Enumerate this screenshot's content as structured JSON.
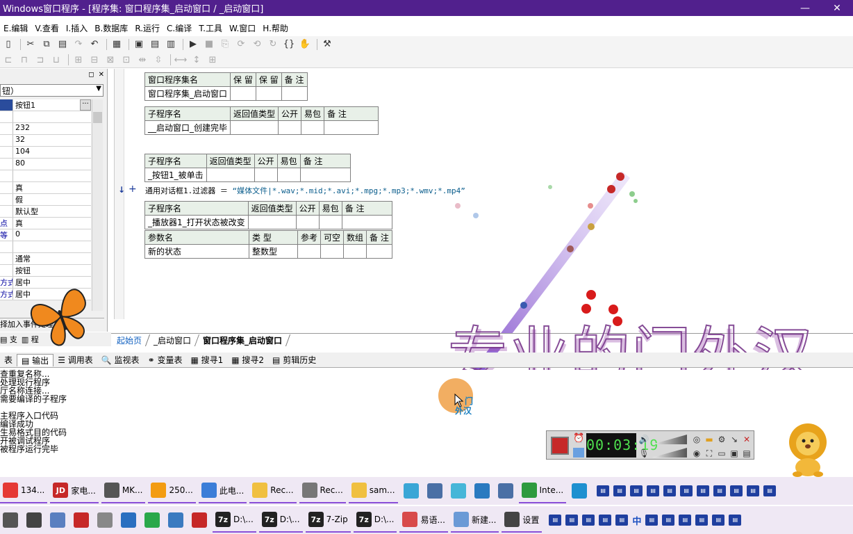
{
  "window": {
    "title": "Windows窗口程序 - [程序集: 窗口程序集_启动窗口 / _启动窗口]",
    "minimize": "—",
    "close": "✕"
  },
  "menu": [
    "E.编辑",
    "V.查看",
    "I.插入",
    "B.数据库",
    "R.运行",
    "C.编译",
    "T.工具",
    "W.窗口",
    "H.帮助"
  ],
  "left_panel": {
    "combo": "钮）",
    "properties": [
      {
        "k": "",
        "v": "按钮1"
      },
      {
        "k": "",
        "v": ""
      },
      {
        "k": "",
        "v": "232"
      },
      {
        "k": "",
        "v": "32"
      },
      {
        "k": "",
        "v": "104"
      },
      {
        "k": "",
        "v": "80"
      },
      {
        "k": "",
        "v": ""
      },
      {
        "k": "",
        "v": "真"
      },
      {
        "k": "",
        "v": "假"
      },
      {
        "k": "",
        "v": "默认型"
      },
      {
        "k": "点",
        "v": "真"
      },
      {
        "k": "等",
        "v": "0"
      },
      {
        "k": "",
        "v": ""
      },
      {
        "k": "",
        "v": "通常"
      },
      {
        "k": "",
        "v": "按钮"
      },
      {
        "k": "方式",
        "v": "居中"
      },
      {
        "k": "方式",
        "v": "居中"
      }
    ],
    "hint": "择加入事件处理子程序",
    "tabs": [
      "支",
      "程"
    ]
  },
  "editor": {
    "assembly_table": {
      "headers": [
        "窗口程序集名",
        "保 留",
        "保 留",
        "备 注"
      ],
      "row": [
        "窗口程序集_启动窗口",
        "",
        "",
        ""
      ]
    },
    "sub1": {
      "headers": [
        "子程序名",
        "返回值类型",
        "公开",
        "易包",
        "备 注"
      ],
      "row": [
        "__启动窗口_创建完毕",
        "",
        "",
        "",
        ""
      ]
    },
    "sub2": {
      "headers": [
        "子程序名",
        "返回值类型",
        "公开",
        "易包",
        "备 注"
      ],
      "row": [
        "_按钮1_被单击",
        "",
        "",
        "",
        ""
      ]
    },
    "code_line": "通用对话框1.过滤器 ＝ ",
    "code_string": "“媒体文件|*.wav;*.mid;*.avi;*.mpg;*.mp3;*.wmv;*.mp4”",
    "sub3": {
      "headers": [
        "子程序名",
        "返回值类型",
        "公开",
        "易包",
        "备 注"
      ],
      "row": [
        "_播放器1_打开状态被改变",
        "",
        "",
        "",
        ""
      ]
    },
    "params": {
      "headers": [
        "参数名",
        "类 型",
        "参考",
        "可空",
        "数组",
        "备 注"
      ],
      "row": [
        "新的状态",
        "整数型",
        "",
        "",
        "",
        ""
      ]
    },
    "marker": "↓",
    "plus": "+"
  },
  "doc_tabs": [
    "起始页",
    "_启动窗口",
    "窗口程序集_启动窗口"
  ],
  "bottom_tabs": [
    "表",
    "输出",
    "调用表",
    "监视表",
    "变量表",
    "搜寻1",
    "搜寻2",
    "剪辑历史"
  ],
  "output_lines": [
    "查重复名称...",
    "处理现行程序",
    "厅名称连接...",
    "需要编译的子程序",
    "",
    "主程序入口代码",
    "编译成功",
    "生易格式目的代码",
    "开被调试程序",
    "被程序运行完毕"
  ],
  "watermark": "专业的门外汉",
  "cursor_caption": [
    "门",
    "外汉"
  ],
  "recorder": {
    "time": "00:03:19"
  },
  "taskbar_top": [
    {
      "label": "134...",
      "icon": "chrome-icon",
      "color": "#e53935"
    },
    {
      "label": "家电...",
      "icon": "jd-icon",
      "color": "#c62828",
      "text": "JD"
    },
    {
      "label": "MK...",
      "icon": "mk-icon",
      "color": "#555"
    },
    {
      "label": "250...",
      "icon": "search-icon",
      "color": "#f39c12"
    },
    {
      "label": "此电...",
      "icon": "pc-icon",
      "color": "#3b7dd8"
    },
    {
      "label": "Rec...",
      "icon": "folder-icon",
      "color": "#f0c040"
    },
    {
      "label": "Rec...",
      "icon": "app-icon",
      "color": "#777"
    },
    {
      "label": "sam...",
      "icon": "folder-icon",
      "color": "#f0c040"
    },
    {
      "label": "",
      "icon": "swirl-icon",
      "color": "#3aa6d6"
    },
    {
      "label": "",
      "icon": "translate-icon",
      "color": "#4a6fa5"
    },
    {
      "label": "",
      "icon": "atom-icon",
      "color": "#46b6d8"
    },
    {
      "label": "",
      "icon": "db-icon",
      "color": "#2a7ac0"
    },
    {
      "label": "",
      "icon": "network-icon",
      "color": "#4a6fa5"
    },
    {
      "label": "Inte...",
      "icon": "globe-icon",
      "color": "#2e9a3e"
    },
    {
      "label": "",
      "icon": "frame-icon",
      "color": "#1e90d0"
    }
  ],
  "taskbar_bottom": [
    {
      "label": "",
      "icon": "windows-icon",
      "color": "#555"
    },
    {
      "label": "",
      "icon": "calc-icon",
      "color": "#444"
    },
    {
      "label": "",
      "icon": "r-icon",
      "color": "#5a7fc0"
    },
    {
      "label": "",
      "icon": "record-icon",
      "color": "#c62828"
    },
    {
      "label": "",
      "icon": "disc-icon",
      "color": "#888"
    },
    {
      "label": "",
      "icon": "box-icon",
      "color": "#2a6fc0"
    },
    {
      "label": "",
      "icon": "diamond-icon",
      "color": "#2aa84a"
    },
    {
      "label": "",
      "icon": "screen-icon",
      "color": "#3a7ac0"
    },
    {
      "label": "",
      "icon": "magnify-icon",
      "color": "#c62828"
    },
    {
      "label": "D:\\...",
      "icon": "7z-icon",
      "color": "#222",
      "text": "7z"
    },
    {
      "label": "D:\\...",
      "icon": "7z-icon",
      "color": "#222",
      "text": "7z"
    },
    {
      "label": "7-Zip",
      "icon": "7z-icon",
      "color": "#222",
      "text": "7z"
    },
    {
      "label": "D:\\...",
      "icon": "7z-icon",
      "color": "#222",
      "text": "7z"
    },
    {
      "label": "易语...",
      "icon": "e-lang-icon",
      "color": "#d84a4a"
    },
    {
      "label": "新建...",
      "icon": "notepad-icon",
      "color": "#6a9ad6"
    },
    {
      "label": "设置",
      "icon": "gear-icon",
      "color": "#444"
    }
  ],
  "tray_lang": "中",
  "colors": {
    "titlebar": "#51208d",
    "watermark": "#7a3a8c",
    "accent": "#8a4fd8"
  }
}
